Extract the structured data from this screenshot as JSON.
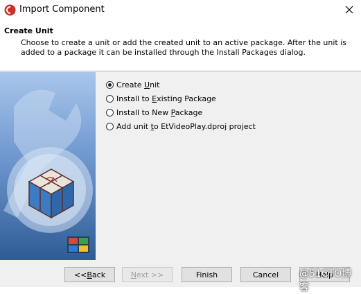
{
  "window": {
    "title": "Import Component",
    "close_icon": "close-icon"
  },
  "header": {
    "title": "Create Unit",
    "description": "Choose to create a unit or add the created unit to an active package. After the unit is added to a package it can be installed through the Install Packages dialog."
  },
  "options": [
    {
      "pre": "Create ",
      "accel": "U",
      "post": "nit",
      "checked": true
    },
    {
      "pre": "Install to ",
      "accel": "E",
      "post": "xisting Package",
      "checked": false
    },
    {
      "pre": "Install to New ",
      "accel": "P",
      "post": "ackage",
      "checked": false
    },
    {
      "pre": "Add unit ",
      "accel": "t",
      "post": "o EtVideoPlay.dproj project",
      "checked": false
    }
  ],
  "buttons": {
    "back_pre": "<< ",
    "back_accel": "B",
    "back_post": "ack",
    "next_accel": "N",
    "next_post": "ext >>",
    "finish": "Finish",
    "cancel": "Cancel",
    "help": "Help"
  },
  "watermark": "@51CTO博客",
  "colors": {
    "side_panel": "#3d6aa3",
    "dialog_bg": "#f0f0f0"
  }
}
